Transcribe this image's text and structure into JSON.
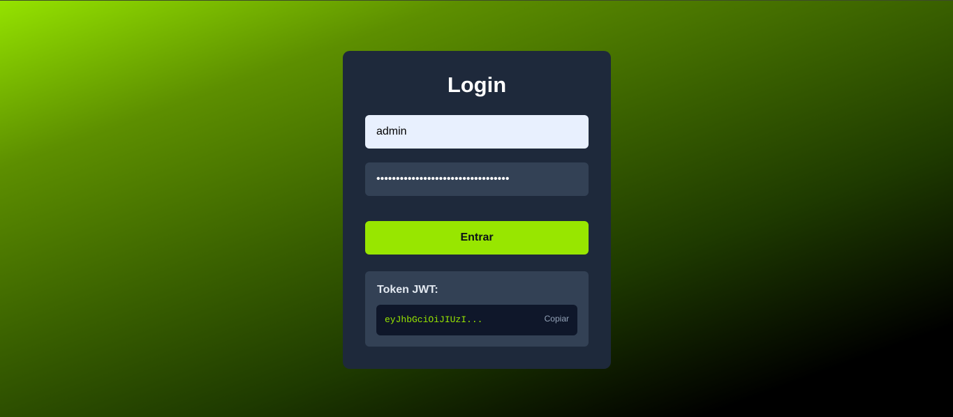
{
  "colors": {
    "accent": "#98e600",
    "card_bg": "#1e293b",
    "panel_bg": "#334155",
    "token_bg": "#0f172a"
  },
  "login": {
    "title": "Login",
    "username_value": "admin",
    "password_value": "••••••••••••••••••••••••••••••••••",
    "submit_label": "Entrar"
  },
  "token": {
    "label": "Token JWT:",
    "value": "eyJhbGciOiJIUzI...",
    "copy_label": "Copiar"
  }
}
